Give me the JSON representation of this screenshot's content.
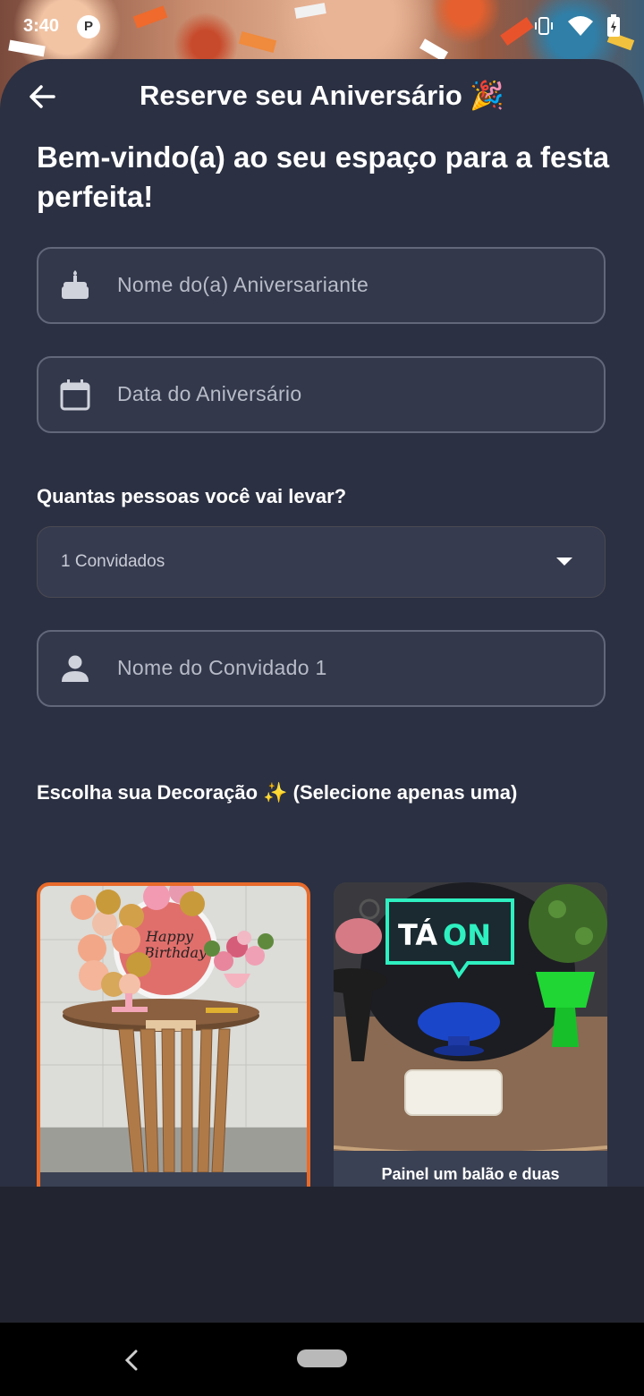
{
  "status_bar": {
    "time": "3:40",
    "battery_level": "5"
  },
  "app_bar": {
    "title": "Reserve seu Aniversário 🎉"
  },
  "welcome_text": "Bem-vindo(a) ao seu espaço para a festa perfeita!",
  "fields": {
    "birthday_person_placeholder": "Nome do(a) Aniversariante",
    "birthday_date_placeholder": "Data do Aniversário",
    "guest_name_placeholder": "Nome do Convidado 1"
  },
  "guests": {
    "question": "Quantas pessoas você vai levar?",
    "selected_value": "1 Convidados"
  },
  "decoration": {
    "heading": "Escolha sua Decoração ✨ (Selecione apenas uma)",
    "cards": [
      {
        "caption": "",
        "image": "happy-birthday-table-photo",
        "selected": true
      },
      {
        "caption": "Painel um balão e duas",
        "image": "ta-on-table-photo",
        "selected": false
      }
    ]
  },
  "colors": {
    "background": "#2b3042",
    "accent": "#e86a2a",
    "field_border": "#626779"
  }
}
